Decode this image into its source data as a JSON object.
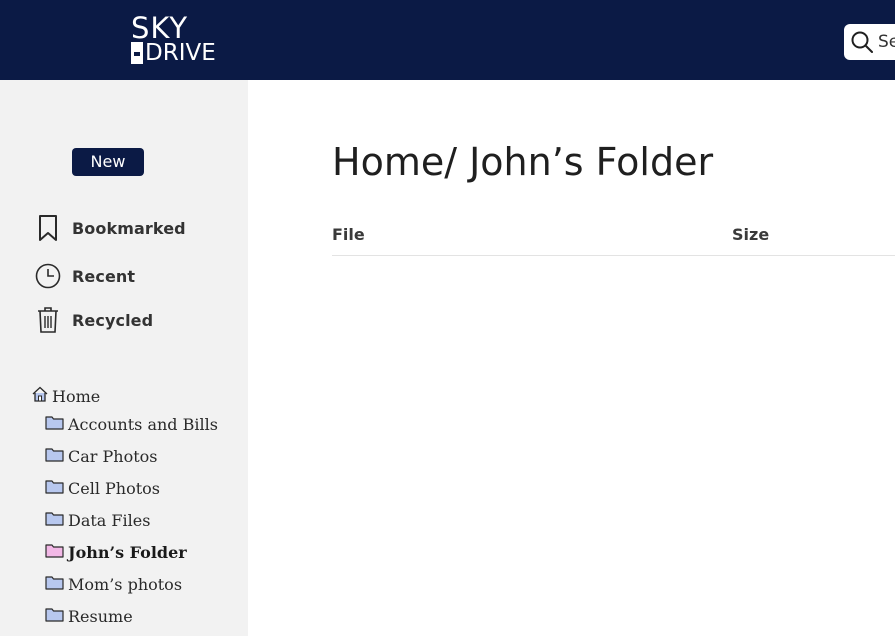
{
  "app": {
    "logo_top": "SKY",
    "logo_bottom": "DRIVE"
  },
  "colors": {
    "header_bg": "#0b1a45",
    "sidebar_bg": "#f2f2f2",
    "folder_default": "#b8c8ef",
    "folder_active": "#f2b8e6"
  },
  "search": {
    "placeholder": "Search"
  },
  "sidebar": {
    "new_label": "New",
    "nav": [
      {
        "label": "Bookmarked",
        "icon": "bookmark-icon"
      },
      {
        "label": "Recent",
        "icon": "clock-icon"
      },
      {
        "label": "Recycled",
        "icon": "trash-icon"
      }
    ],
    "tree": {
      "home": {
        "label": "Home",
        "icon": "home-icon"
      },
      "folders": [
        {
          "label": "Accounts and Bills",
          "active": false
        },
        {
          "label": "Car Photos",
          "active": false
        },
        {
          "label": "Cell Photos",
          "active": false
        },
        {
          "label": "Data Files",
          "active": false
        },
        {
          "label": "John’s Folder",
          "active": true
        },
        {
          "label": "Mom’s photos",
          "active": false
        },
        {
          "label": "Resume",
          "active": false
        }
      ]
    }
  },
  "main": {
    "title": "Home/ John’s Folder",
    "columns": {
      "file": "File",
      "size": "Size"
    }
  }
}
